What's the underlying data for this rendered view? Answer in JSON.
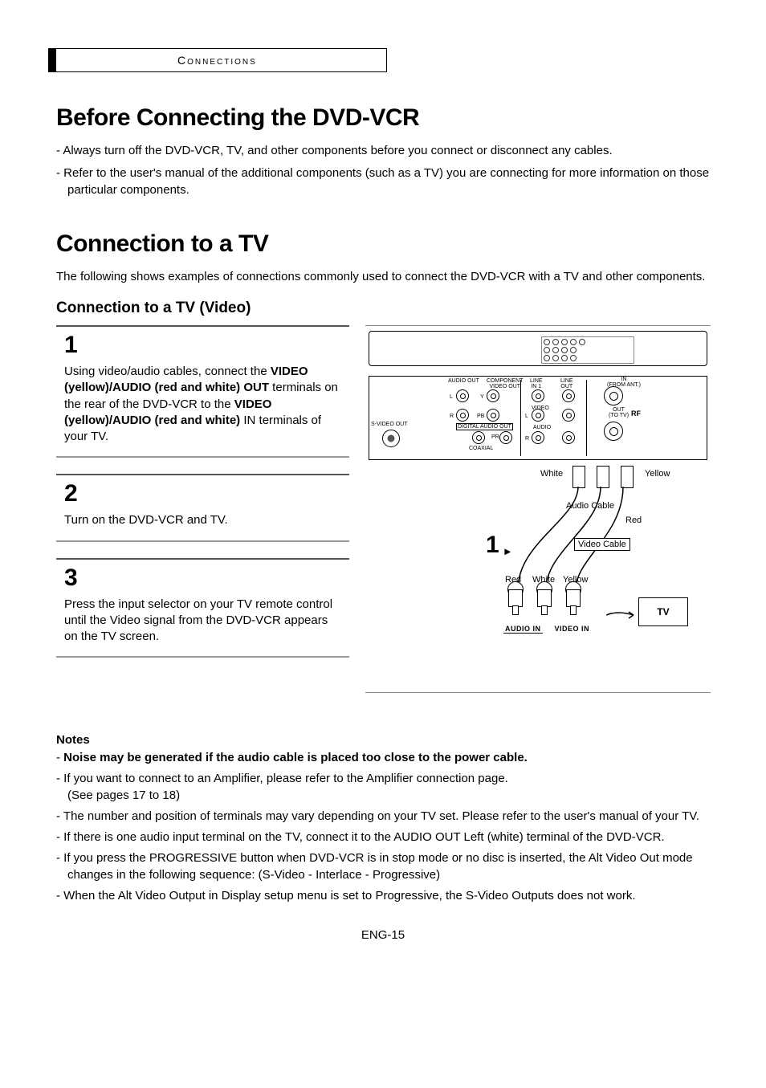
{
  "section_tab": "Connections",
  "heading1": "Before Connecting the DVD-VCR",
  "intro_bullets": [
    "Always turn off the DVD-VCR, TV, and other components before you connect or disconnect any cables.",
    "Refer to the user's manual of the additional components (such as a TV) you are connecting for more information on those particular components."
  ],
  "heading2": "Connection to a TV",
  "following_text": "The following shows examples of connections commonly used to connect the DVD-VCR with a TV and other components.",
  "sub_heading": "Connection to a TV (Video)",
  "steps": [
    {
      "num": "1",
      "text_pre": "Using video/audio cables, connect the ",
      "bold1": "VIDEO (yellow)/AUDIO (red and white) OUT",
      "mid1": " terminals on the rear of the DVD-VCR to the ",
      "bold2": "VIDEO (yellow)/AUDIO (red and white)",
      "mid2": " IN terminals of your TV."
    },
    {
      "num": "2",
      "text": "Turn on the DVD-VCR and TV."
    },
    {
      "num": "3",
      "text": "Press the input selector on your TV remote control until the Video signal from the DVD-VCR appears on the TV screen."
    }
  ],
  "diagram": {
    "rear_labels": {
      "svideo": "S-VIDEO OUT",
      "audio_out": "AUDIO OUT",
      "component": "COMPONENT\nVIDEO OUT",
      "digital": "DIGITAL AUDIO OUT",
      "coaxial": "COAXIAL",
      "line_in1": "LINE\nIN 1",
      "video": "VIDEO",
      "audio": "AUDIO",
      "line_out": "LINE\nOUT",
      "in_from_ant": "IN\n(FROM ANT.)",
      "out_to_tv": "OUT\n(TO TV)",
      "rf": "RF",
      "l": "L",
      "r": "R",
      "y": "Y",
      "pb": "PB",
      "pr": "PR"
    },
    "colors": {
      "white": "White",
      "red": "Red",
      "yellow": "Yellow"
    },
    "audio_cable": "Audio Cable",
    "video_cable": "Video Cable",
    "step_marker": "1",
    "tv": "TV",
    "audio_in": "AUDIO IN",
    "video_in": "VIDEO IN"
  },
  "notes_heading": "Notes",
  "notes": [
    {
      "bold": true,
      "text": "Noise may be generated if the audio cable is placed too close to the power cable."
    },
    {
      "bold": false,
      "text": "If you want to connect to an Amplifier, please refer to the Amplifier connection page.\n(See pages 17 to 18)"
    },
    {
      "bold": false,
      "text": "The number and position of terminals may vary depending on your TV set. Please refer to the user's manual of your TV."
    },
    {
      "bold": false,
      "text": "If there is one audio input terminal on the TV, connect it to the AUDIO OUT Left (white) terminal of the DVD-VCR."
    },
    {
      "bold": false,
      "text": "If you press the PROGRESSIVE button when DVD-VCR is in stop mode or no disc is inserted, the Alt Video Out mode changes in the following sequence: (S-Video - Interlace - Progressive)"
    },
    {
      "bold": false,
      "text": "When the Alt Video Output in Display setup menu is set to Progressive, the S-Video Outputs does not work."
    }
  ],
  "page_num": "ENG-15"
}
